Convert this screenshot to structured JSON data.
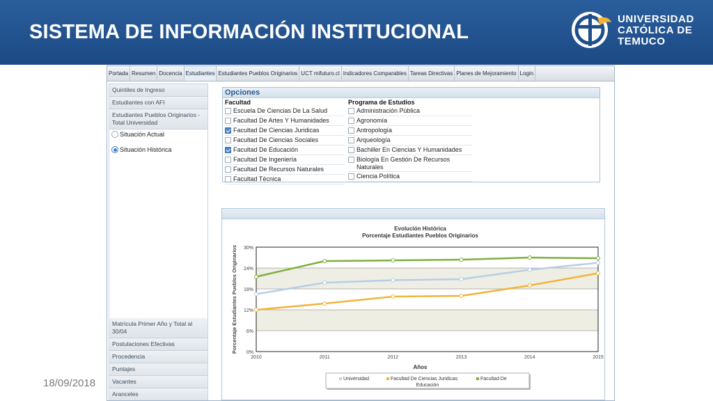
{
  "header": {
    "title": "SISTEMA DE INFORMACIÓN INSTITUCIONAL",
    "logo_lines": [
      "UNIVERSIDAD",
      "CATÓLICA DE",
      "TEMUCO"
    ]
  },
  "footer": {
    "date": "18/09/2018"
  },
  "nav": [
    "Portada",
    "Resumen",
    "Docencia",
    "Estudiantes",
    "Estudiantes Pueblos Originarios",
    "UCT mifuturo.cl",
    "Indicadores Comparables",
    "Tareas Directivas",
    "Planes de Mejoramiento",
    "Login"
  ],
  "sidebar": {
    "top_items": [
      "Quintiles de Ingreso",
      "Estudiantes con AFI",
      "Estudiantes Pueblos Originarios - Total Universidad"
    ],
    "radios": [
      {
        "label": "Situación Actual",
        "selected": false
      },
      {
        "label": "Situación Histórica",
        "selected": true
      }
    ],
    "bottom_items": [
      "Matrícula Primer Año y Total al 30/04",
      "Postulaciones Efectivas",
      "Procedencia",
      "Puntajes",
      "Vacantes",
      "Aranceles"
    ]
  },
  "options": {
    "title": "Opciones",
    "facultad_title": "Facultad",
    "facultad": [
      {
        "label": "Escuela De Ciencias De La Salud",
        "checked": false
      },
      {
        "label": "Facultad De Artes Y Humanidades",
        "checked": false
      },
      {
        "label": "Facultad De Ciencias Juridicas",
        "checked": true
      },
      {
        "label": "Facultad De Ciencias Sociales",
        "checked": false
      },
      {
        "label": "Facultad De Educación",
        "checked": true
      },
      {
        "label": "Facultad De Ingeniería",
        "checked": false
      },
      {
        "label": "Facultad De Recursos Naturales",
        "checked": false
      },
      {
        "label": "Facultad Técnica",
        "checked": false
      }
    ],
    "programa_title": "Programa de Estudios",
    "programa": [
      {
        "label": "Administración Pública",
        "checked": false
      },
      {
        "label": "Agronomía",
        "checked": false
      },
      {
        "label": "Antropología",
        "checked": false
      },
      {
        "label": "Arqueología",
        "checked": false
      },
      {
        "label": "Bachiller En Ciencias Y Humanidades",
        "checked": false
      },
      {
        "label": "Biología En Gestión De Recursos Naturales",
        "checked": false
      },
      {
        "label": "Ciencia Política",
        "checked": false
      }
    ]
  },
  "colors": {
    "header": "#1f4f8a",
    "universidad": "#b8cde6",
    "juridicas": "#f0b43a",
    "educacion": "#7faf3c"
  },
  "chart_data": {
    "type": "line",
    "title": "Evolución Histórica",
    "subtitle": "Porcentaje Estudiantes Pueblos Originarios",
    "xlabel": "Años",
    "ylabel": "Porcentaje Estudiantes Pueblos Originarios",
    "x": [
      2010,
      2011,
      2012,
      2013,
      2014,
      2015
    ],
    "ylim": [
      0,
      30
    ],
    "yticks": [
      "0%",
      "6%",
      "12%",
      "18%",
      "24%",
      "30%"
    ],
    "series": [
      {
        "name": "Universidad",
        "color": "#b8cde6",
        "values": [
          16.5,
          19.8,
          20.5,
          20.8,
          23.5,
          25.5
        ]
      },
      {
        "name": "Facultad De Ciencias Juridicas",
        "color": "#f0b43a",
        "values": [
          12,
          13.8,
          15.8,
          16,
          19,
          22.5
        ]
      },
      {
        "name": "Facultad De Educación",
        "color": "#7faf3c",
        "values": [
          21.5,
          26,
          26.2,
          26.4,
          27,
          26.8
        ]
      }
    ],
    "legend": "bottom",
    "grid": true
  }
}
